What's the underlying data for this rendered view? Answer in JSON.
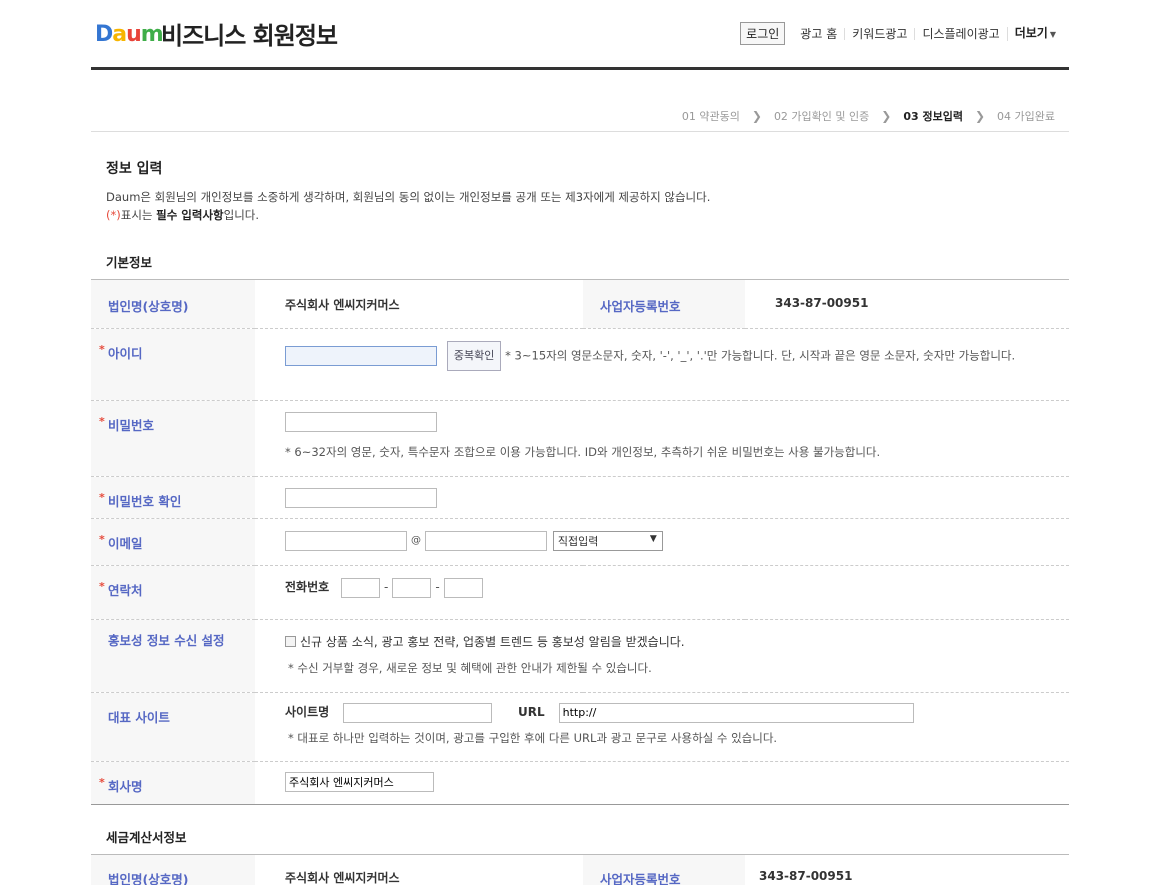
{
  "header": {
    "logo_text": [
      "D",
      "a",
      "u",
      "m"
    ],
    "title": "비즈니스 회원정보",
    "nav": {
      "login": "로그인",
      "items": [
        "광고 홈",
        "키워드광고",
        "디스플레이광고"
      ],
      "more": "더보기"
    }
  },
  "steps": [
    {
      "label": "01 약관동의",
      "current": false
    },
    {
      "label": "02 가입확인 및 인증",
      "current": false
    },
    {
      "label": "03 정보입력",
      "current": true
    },
    {
      "label": "04 가입완료",
      "current": false
    }
  ],
  "intro": {
    "title": "정보 입력",
    "desc": "Daum은 회원님의 개인정보를 소중하게 생각하며, 회원님의 동의 없이는 개인정보를 공개 또는 제3자에게 제공하지 않습니다.",
    "req_mark": "(*)",
    "req_prefix": "표시는 ",
    "req_strong": "필수 입력사항",
    "req_suffix": "입니다."
  },
  "basic": {
    "section_title": "기본정보",
    "company_label": "법인명(상호명)",
    "company_value": "주식회사 엔씨지커머스",
    "bizno_label": "사업자등록번호",
    "bizno_value": "343-87-00951",
    "id_label": "아이디",
    "id_check_button": "중복확인",
    "id_hint": "* 3~15자의 영문소문자, 숫자, '-', '_', '.'만 가능합니다. 단, 시작과 끝은 영문 소문자, 숫자만 가능합니다.",
    "pw_label": "비밀번호",
    "pw_hint": "* 6~32자의 영문, 숫자, 특수문자 조합으로 이용 가능합니다. ID와 개인정보, 추측하기 쉬운 비밀번호는 사용 불가능합니다.",
    "pw_confirm_label": "비밀번호 확인",
    "email_label": "이메일",
    "email_at": "@",
    "email_domain_select": "직접입력",
    "phone_label": "연락처",
    "phone_sub_label": "전화번호",
    "phone_dash": "-",
    "promo_label": "홍보성 정보 수신 설정",
    "promo_check_text": "신규 상품 소식, 광고 홍보 전략, 업종별 트렌드 등 홍보성 알림을 받겠습니다.",
    "promo_hint": "* 수신 거부할 경우, 새로운 정보 및 혜택에 관한 안내가 제한될 수 있습니다.",
    "site_label": "대표 사이트",
    "site_name_label": "사이트명",
    "site_url_label": "URL",
    "site_url_value": "http://",
    "site_hint": "* 대표로 하나만 입력하는 것이며, 광고를 구입한 후에 다른 URL과 광고 문구로 사용하실 수 있습니다.",
    "corp_name_label": "회사명",
    "corp_name_value": "주식회사 엔씨지커머스",
    "required_mark": "*"
  },
  "tax": {
    "section_title": "세금계산서정보",
    "company_label": "법인명(상호명)",
    "company_value": "주식회사 엔씨지커머스",
    "bizno_label": "사업자등록번호",
    "bizno_value": "343-87-00951"
  },
  "colors": {
    "label_blue": "#5668c4",
    "required_red": "#e64a3b",
    "header_rule": "#333333"
  }
}
